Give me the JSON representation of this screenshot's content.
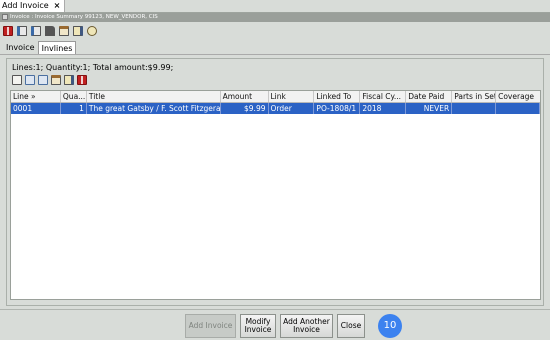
{
  "window": {
    "tab_title": "Add Invoice",
    "close_glyph": "×"
  },
  "path": "Invoice : Invoice Summary 99123, NEW_VENDOR, CIS",
  "toolbar_icons": [
    "book-icon",
    "document-stack-icon",
    "document-copy-icon",
    "flag-icon",
    "calendar-icon",
    "edit-icon",
    "settings-icon"
  ],
  "tabs": [
    {
      "label": "Invoice",
      "active": false
    },
    {
      "label": "Invlines",
      "active": true
    }
  ],
  "summary": "Lines:1; Quantity:1; Total amount:$9.99;",
  "grid_icons": [
    "new-line-icon",
    "move-line-icon",
    "copy-line-icon",
    "calendar-line-icon",
    "edit-line-icon",
    "book-line-icon"
  ],
  "table": {
    "columns": [
      "Line »",
      "Qua...",
      "Title",
      "Amount",
      "Link",
      "Linked To",
      "Fiscal Cy...",
      "Date Paid",
      "Parts in Set",
      "Coverage"
    ],
    "rows": [
      [
        "0001",
        "1",
        "The great Gatsby / F. Scott Fitzgerald",
        "$9.99",
        "Order",
        "PO-1808/1",
        "2018",
        "NEVER",
        "",
        ""
      ]
    ]
  },
  "buttons": {
    "add_invoice": "Add Invoice",
    "modify_invoice": "Modify Invoice",
    "add_another_invoice": "Add Another Invoice",
    "close": "Close"
  },
  "badge": "10",
  "colors": {
    "selection": "#2b62c5",
    "badge": "#3c82ef",
    "path_bar": "#9a9f9a"
  }
}
